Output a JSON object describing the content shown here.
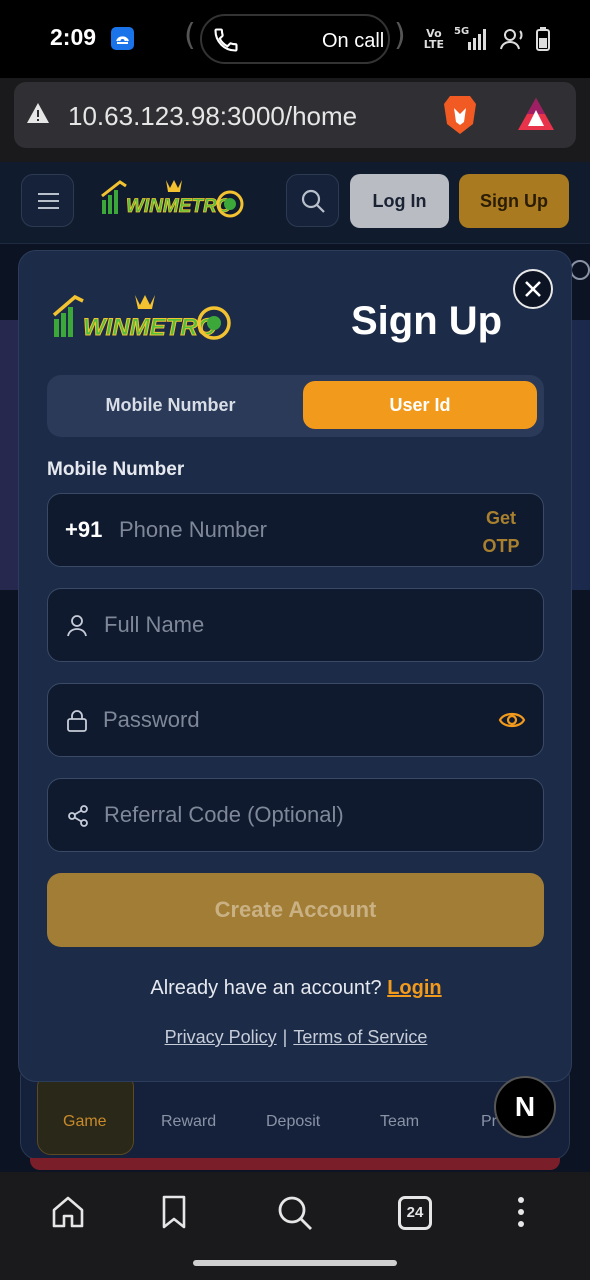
{
  "status_bar": {
    "time": "2:09",
    "call_status": "On call",
    "volte": "Vo",
    "lte": "LTE",
    "network": "5G"
  },
  "browser": {
    "url": "10.63.123.98:3000/home",
    "tab_count": "24"
  },
  "header": {
    "logo_text": "WINMETRO",
    "login_label": "Log In",
    "signup_label": "Sign Up"
  },
  "bottom_nav": {
    "items": [
      "Game",
      "Reward",
      "Deposit",
      "Team",
      "Pr"
    ]
  },
  "badge": {
    "letter": "N"
  },
  "modal": {
    "title": "Sign Up",
    "tabs": [
      {
        "label": "Mobile Number",
        "active": false
      },
      {
        "label": "User Id",
        "active": true
      }
    ],
    "mobile_label": "Mobile Number",
    "country_code": "+91",
    "phone_placeholder": "Phone Number",
    "get_otp_line1": "Get",
    "get_otp_line2": "OTP",
    "full_name_placeholder": "Full Name",
    "password_placeholder": "Password",
    "referral_placeholder": "Referral Code (Optional)",
    "create_button": "Create Account",
    "have_account_text": "Already have an account?",
    "login_link": "Login",
    "privacy_link": "Privacy Policy",
    "separator": "|",
    "terms_link": "Terms of Service"
  },
  "colors": {
    "accent_orange": "#f29a1c",
    "gold": "#a27d35",
    "modal_bg": "#1c2b48",
    "input_bg": "#0f1a2e"
  }
}
